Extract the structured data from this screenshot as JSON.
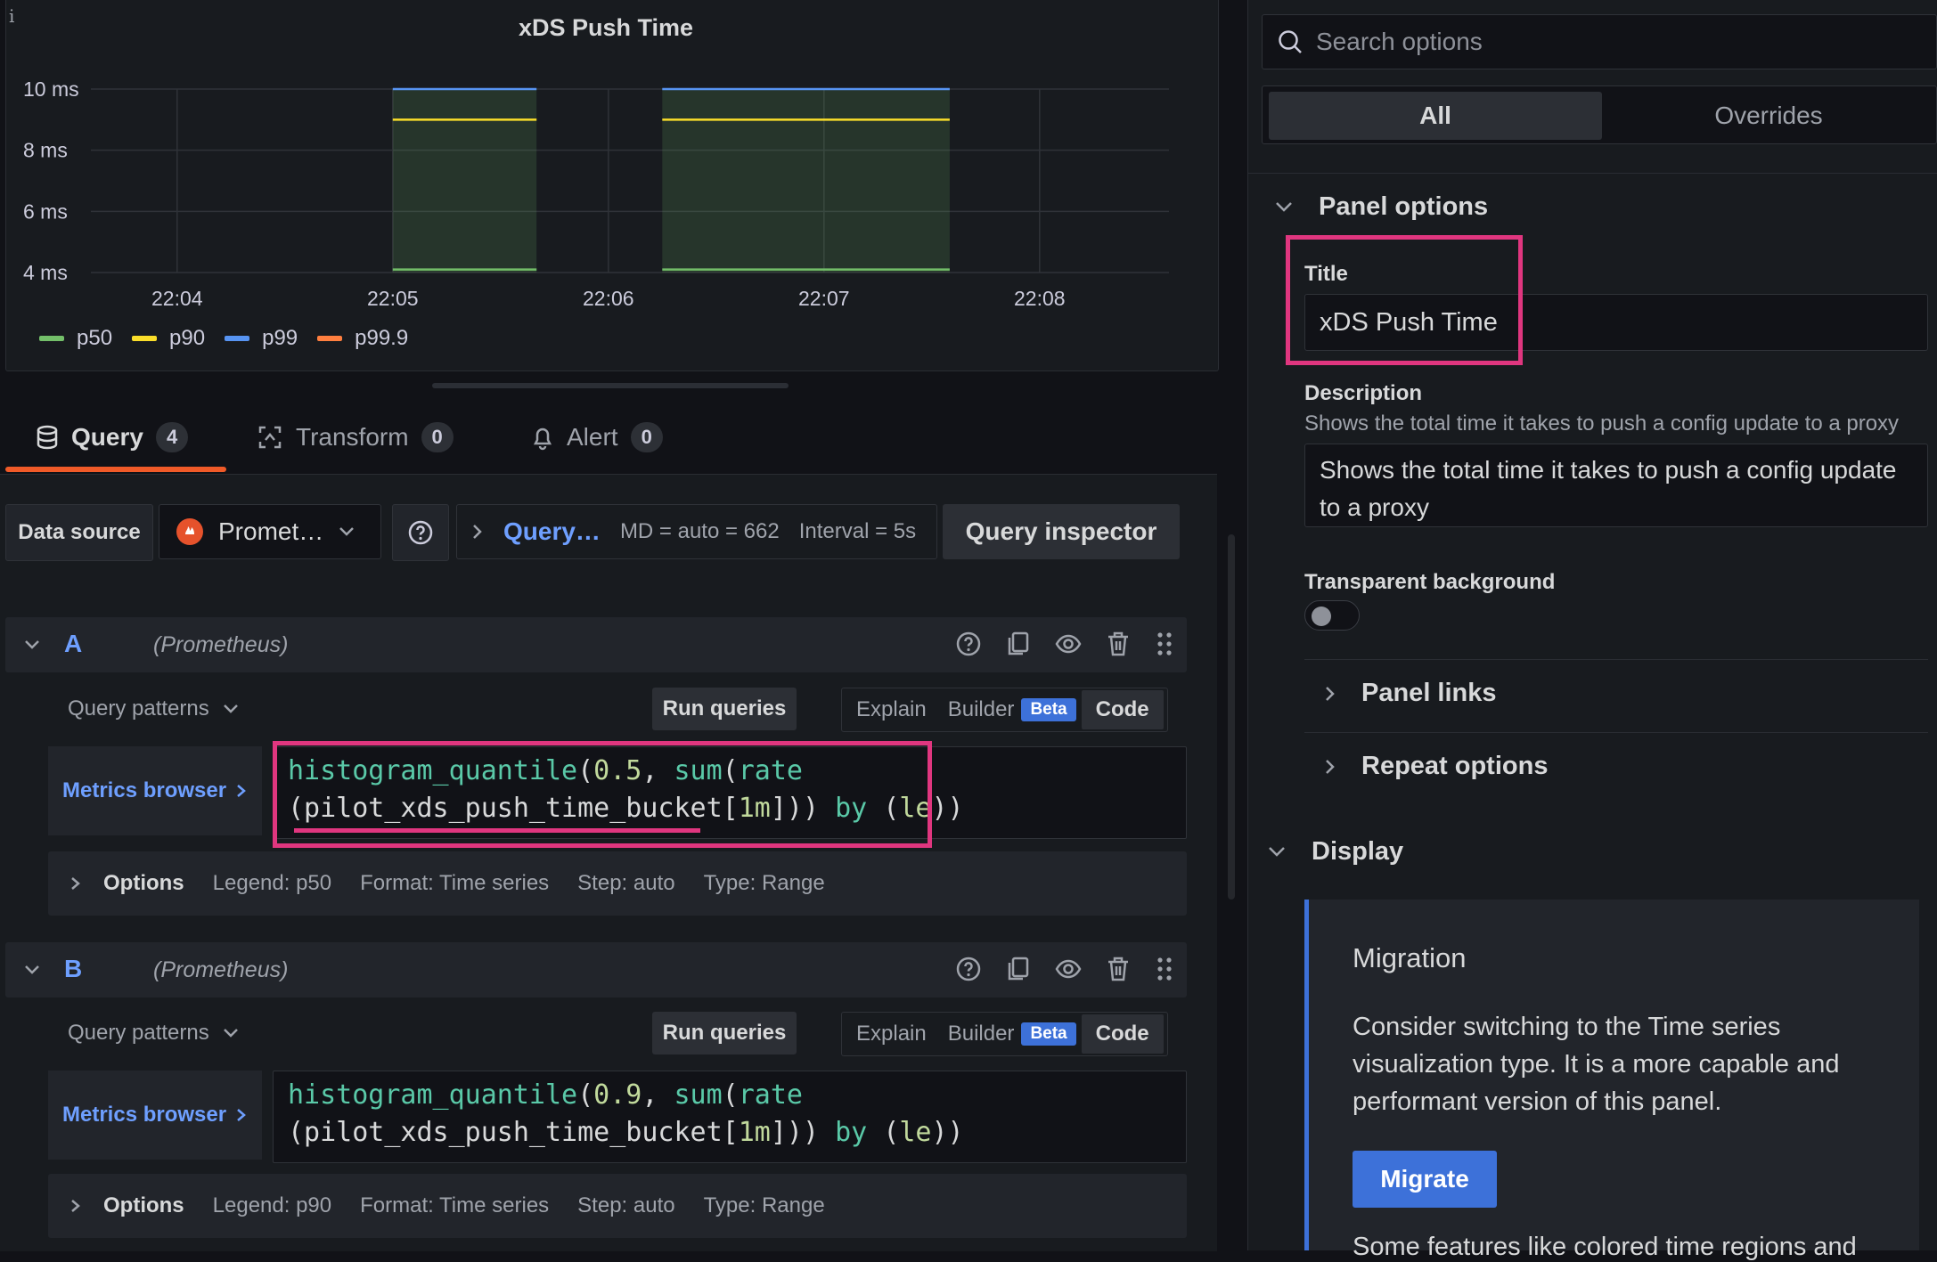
{
  "panel": {
    "info_glyph": "i",
    "title": "xDS Push Time"
  },
  "chart_data": {
    "type": "line",
    "title": "xDS Push Time",
    "y_unit": "ms",
    "y_ticks": [
      "4 ms",
      "6 ms",
      "8 ms",
      "10 ms"
    ],
    "ylim": [
      4,
      10
    ],
    "x_ticks": [
      "22:04",
      "22:05",
      "22:06",
      "22:07",
      "22:08"
    ],
    "x_tick_values_min": [
      4,
      5,
      6,
      7,
      8
    ],
    "xlim_min": [
      3.6,
      8.6
    ],
    "segments_min": [
      [
        5.0,
        5.667
      ],
      [
        6.25,
        7.583
      ]
    ],
    "series": [
      {
        "name": "p50",
        "color": "#73bf69",
        "value": 4.1
      },
      {
        "name": "p90",
        "color": "#fade2a",
        "value": 9.0
      },
      {
        "name": "p99",
        "color": "#5794f2",
        "value": 10.0
      },
      {
        "name": "p99.9",
        "color": "#ff7f3f",
        "value": null
      }
    ]
  },
  "tabs": [
    {
      "label": "Query",
      "count": "4"
    },
    {
      "label": "Transform",
      "count": "0"
    },
    {
      "label": "Alert",
      "count": "0"
    }
  ],
  "toolbar": {
    "datasource_label": "Data source",
    "datasource_value": "Promet…",
    "query_options_link": "Query…",
    "md": "MD = auto = 662",
    "interval": "Interval = 5s",
    "inspector": "Query inspector"
  },
  "queries": [
    {
      "letter": "A",
      "datasource": "(Prometheus)",
      "patterns": "Query patterns",
      "run": "Run queries",
      "modes": {
        "explain": "Explain",
        "builder": "Builder",
        "beta": "Beta",
        "code": "Code"
      },
      "metrics_browser": "Metrics browser",
      "code_line1": {
        "fn": "histogram_quantile",
        "p1": "(",
        "q": "0.5",
        "p2": ", ",
        "fn2": "sum",
        "p3": "(",
        "fn3": "rate"
      },
      "code_line2": {
        "p1": "(pilot_xds_push_time_bucket[",
        "d": "1m",
        "p2": "])) ",
        "kw": "by",
        "p3": " (",
        "lbl": "le",
        "p4": "))"
      },
      "options": {
        "label": "Options",
        "legend": "Legend: p50",
        "format": "Format: Time series",
        "step": "Step: auto",
        "type": "Type: Range"
      }
    },
    {
      "letter": "B",
      "datasource": "(Prometheus)",
      "patterns": "Query patterns",
      "run": "Run queries",
      "modes": {
        "explain": "Explain",
        "builder": "Builder",
        "beta": "Beta",
        "code": "Code"
      },
      "metrics_browser": "Metrics browser",
      "code_line1": {
        "fn": "histogram_quantile",
        "p1": "(",
        "q": "0.9",
        "p2": ", ",
        "fn2": "sum",
        "p3": "(",
        "fn3": "rate"
      },
      "code_line2": {
        "p1": "(pilot_xds_push_time_bucket[",
        "d": "1m",
        "p2": "])) ",
        "kw": "by",
        "p3": " (",
        "lbl": "le",
        "p4": "))"
      },
      "options": {
        "label": "Options",
        "legend": "Legend: p90",
        "format": "Format: Time series",
        "step": "Step: auto",
        "type": "Type: Range"
      }
    }
  ],
  "options_pane": {
    "search_placeholder": "Search options",
    "tab_all": "All",
    "tab_overrides": "Overrides",
    "panel_options": "Panel options",
    "title_label": "Title",
    "title_value": "xDS Push Time",
    "description_label": "Description",
    "description_help": "Shows the total time it takes to push a config update to a proxy",
    "description_value": "Shows the total time it takes to push a config update to a proxy",
    "transparent_label": "Transparent background",
    "panel_links": "Panel links",
    "repeat_options": "Repeat options",
    "display": "Display",
    "migration_title": "Migration",
    "migration_text": "Consider switching to the Time series visualization type. It is a more capable and performant version of this panel.",
    "migrate_button": "Migrate",
    "migration_more": "Some features like colored time regions and"
  },
  "colors": {
    "accent": "#3d71d9",
    "tab_active": "#f05a28",
    "highlight": "#e0367f",
    "link": "#6e9fff"
  }
}
